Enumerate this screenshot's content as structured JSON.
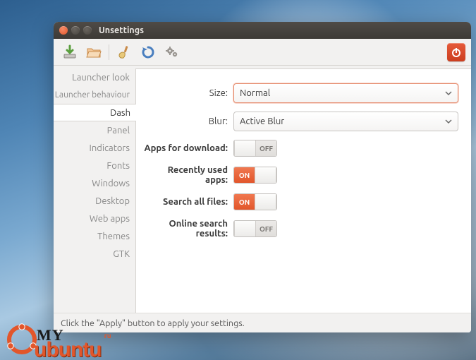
{
  "window": {
    "title": "Unsettings"
  },
  "toolbar": {
    "icons": [
      "download-icon",
      "folder-icon",
      "brush-icon",
      "refresh-icon",
      "gears-icon"
    ],
    "power": "power-icon"
  },
  "sidebar": {
    "items": [
      {
        "label": "Launcher look",
        "selected": false
      },
      {
        "label": "Launcher behaviour",
        "selected": false
      },
      {
        "label": "Dash",
        "selected": true
      },
      {
        "label": "Panel",
        "selected": false
      },
      {
        "label": "Indicators",
        "selected": false
      },
      {
        "label": "Fonts",
        "selected": false
      },
      {
        "label": "Windows",
        "selected": false
      },
      {
        "label": "Desktop",
        "selected": false
      },
      {
        "label": "Web apps",
        "selected": false
      },
      {
        "label": "Themes",
        "selected": false
      },
      {
        "label": "GTK",
        "selected": false
      }
    ]
  },
  "form": {
    "size": {
      "label": "Size:",
      "value": "Normal"
    },
    "blur": {
      "label": "Blur:",
      "value": "Active Blur"
    },
    "apps_dl": {
      "label": "Apps for download:",
      "on": false
    },
    "recent": {
      "label": "Recently used apps:",
      "on": true
    },
    "search": {
      "label": "Search all files:",
      "on": true
    },
    "online": {
      "label": "Online search results:",
      "on": false
    },
    "on_text": "ON",
    "off_text": "OFF"
  },
  "footer": {
    "hint": "Click the \"Apply\" button to apply your settings."
  },
  "watermark": {
    "my": "MY",
    "ubuntu": "ubuntu",
    "ru": "ru"
  }
}
